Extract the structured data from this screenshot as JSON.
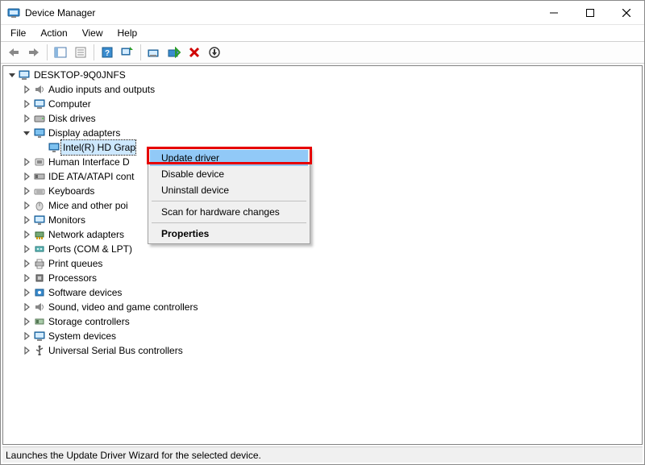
{
  "window": {
    "title": "Device Manager"
  },
  "menubar": {
    "items": [
      "File",
      "Action",
      "View",
      "Help"
    ]
  },
  "toolbar": {
    "buttons": [
      {
        "name": "back-icon"
      },
      {
        "name": "forward-icon"
      },
      {
        "name": "show-hide-console-tree-icon"
      },
      {
        "name": "properties-icon"
      },
      {
        "name": "help-icon"
      },
      {
        "name": "scan-hardware-icon"
      },
      {
        "name": "update-driver-toolbar-icon"
      },
      {
        "name": "disable-icon"
      },
      {
        "name": "uninstall-icon"
      },
      {
        "name": "default-action-icon"
      }
    ]
  },
  "tree": {
    "root": {
      "label": "DESKTOP-9Q0JNFS",
      "expanded": true
    },
    "items": [
      {
        "label": "Audio inputs and outputs",
        "icon": "audio"
      },
      {
        "label": "Computer",
        "icon": "computer"
      },
      {
        "label": "Disk drives",
        "icon": "disk"
      },
      {
        "label": "Display adapters",
        "icon": "display",
        "expanded": true,
        "children": [
          {
            "label": "Intel(R) HD Grap",
            "icon": "display",
            "selected": true
          }
        ]
      },
      {
        "label": "Human Interface D",
        "icon": "hid"
      },
      {
        "label": "IDE ATA/ATAPI cont",
        "icon": "ide"
      },
      {
        "label": "Keyboards",
        "icon": "keyboard"
      },
      {
        "label": "Mice and other poi",
        "icon": "mouse"
      },
      {
        "label": "Monitors",
        "icon": "monitor"
      },
      {
        "label": "Network adapters",
        "icon": "network"
      },
      {
        "label": "Ports (COM & LPT)",
        "icon": "ports"
      },
      {
        "label": "Print queues",
        "icon": "print"
      },
      {
        "label": "Processors",
        "icon": "cpu"
      },
      {
        "label": "Software devices",
        "icon": "software"
      },
      {
        "label": "Sound, video and game controllers",
        "icon": "sound"
      },
      {
        "label": "Storage controllers",
        "icon": "storage"
      },
      {
        "label": "System devices",
        "icon": "system"
      },
      {
        "label": "Universal Serial Bus controllers",
        "icon": "usb"
      }
    ]
  },
  "context_menu": {
    "items": [
      {
        "label": "Update driver",
        "highlight": true
      },
      {
        "label": "Disable device"
      },
      {
        "label": "Uninstall device"
      },
      {
        "separator": true
      },
      {
        "label": "Scan for hardware changes"
      },
      {
        "separator": true
      },
      {
        "label": "Properties",
        "bold": true
      }
    ]
  },
  "statusbar": {
    "text": "Launches the Update Driver Wizard for the selected device."
  }
}
